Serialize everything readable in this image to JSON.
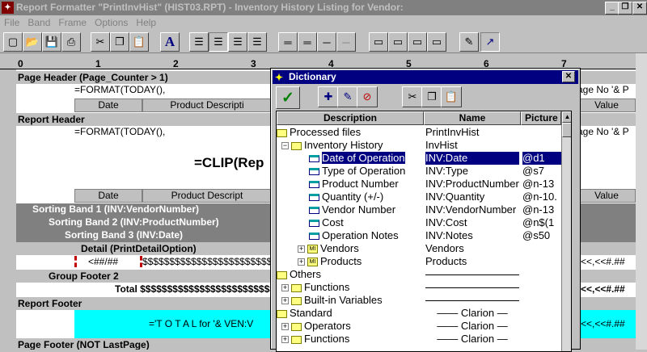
{
  "window": {
    "title": "Report Formatter \"PrintInvHist\" (HIST03.RPT) - Inventory History Listing for Vendor:"
  },
  "menu": [
    "File",
    "Band",
    "Frame",
    "Options",
    "Help"
  ],
  "ruler": [
    "0",
    "1",
    "2",
    "3",
    "4",
    "5",
    "6",
    "7"
  ],
  "report": {
    "page_header": "Page Header (Page_Counter > 1)",
    "format_today_1": "=FORMAT(TODAY(),",
    "page_no_1": "age No '& P",
    "col_date_1": "Date",
    "col_product_1": "Product Descripti",
    "col_value_1": "Value",
    "report_header": "Report Header",
    "format_today_2": "=FORMAT(TODAY(),",
    "page_no_2": "age No '& P",
    "clip": "=CLIP(Rep",
    "col_date_2": "Date",
    "col_product_2": "Product Descript",
    "col_value_2": "Value",
    "sort1": "Sorting Band 1 (INV:VendorNumber)",
    "sort2": "Sorting Band 2 (INV:ProductNumber)",
    "sort3": "Sorting Band 3 (INV:Date)",
    "detail": "Detail (PrintDetailOption)",
    "detail_date": "<##/##",
    "detail_dollars": "$$$$$$$$$$$$$$$$$$$$$$$$$$$$$$$$$$",
    "detail_right": "(<<,<<#.##",
    "group_footer": "Group Footer 2",
    "total_text": "Total $$$$$$$$$$$$$$$$$$$$$$$$$$$$",
    "total_right": "(<<,<<#.##",
    "report_footer": "Report Footer",
    "total_for": "='T O T A L for '& VEN:V",
    "footer_right": "(<<,<<#.##",
    "page_footer": "Page Footer (NOT LastPage)"
  },
  "dictionary": {
    "title": "Dictionary",
    "columns": [
      "Description",
      "Name",
      "Picture"
    ],
    "rows": [
      {
        "desc": "Processed files",
        "name": "PrintInvHist",
        "pic": ""
      },
      {
        "desc": "Inventory History",
        "name": "InvHist",
        "pic": ""
      },
      {
        "desc": "Date of Operation",
        "name": "INV:Date",
        "pic": "@d1"
      },
      {
        "desc": "Type of Operation",
        "name": "INV:Type",
        "pic": "@s7"
      },
      {
        "desc": "Product Number",
        "name": "INV:ProductNumber",
        "pic": "@n-13"
      },
      {
        "desc": "Quantity (+/-)",
        "name": "INV:Quantity",
        "pic": "@n-10."
      },
      {
        "desc": "Vendor Number",
        "name": "INV:VendorNumber",
        "pic": "@n-13"
      },
      {
        "desc": "Cost",
        "name": "INV:Cost",
        "pic": "@n$(1"
      },
      {
        "desc": "Operation Notes",
        "name": "INV:Notes",
        "pic": "@s50"
      },
      {
        "desc": "Vendors",
        "name": "Vendors",
        "pic": ""
      },
      {
        "desc": "Products",
        "name": "Products",
        "pic": ""
      },
      {
        "desc": "Others",
        "name": "",
        "pic": ""
      },
      {
        "desc": "Functions",
        "name": "",
        "pic": ""
      },
      {
        "desc": "Built-in Variables",
        "name": "",
        "pic": ""
      },
      {
        "desc": "Standard",
        "name": "Clarion",
        "pic": ""
      },
      {
        "desc": "Operators",
        "name": "Clarion",
        "pic": ""
      },
      {
        "desc": "Functions",
        "name": "Clarion",
        "pic": ""
      }
    ]
  }
}
